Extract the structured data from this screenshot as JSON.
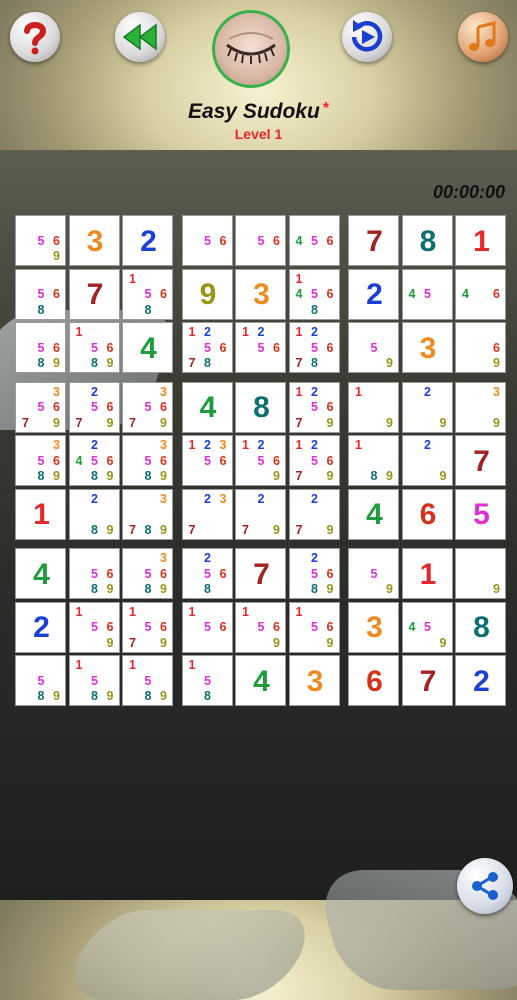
{
  "header": {
    "title": "Easy Sudoku",
    "title_star": "*",
    "level": "Level 1",
    "timer": "00:00:00"
  },
  "buttons": {
    "help_icon": "question-mark",
    "back_icon": "rewind",
    "forward_icon": "play-forward",
    "music_icon": "music-note",
    "eye_icon": "closed-eye",
    "share_icon": "share"
  },
  "colors": {
    "1": "#e8262c",
    "2": "#1c40d6",
    "3": "#f08a1e",
    "4": "#1f9c3c",
    "5": "#e12fd8",
    "6": "#d8311a",
    "7": "#a52222",
    "8": "#0e6f70",
    "9": "#98951b"
  },
  "grid": [
    [
      {
        "c": [
          5,
          6,
          9
        ]
      },
      {
        "v": 3
      },
      {
        "v": 2
      },
      {
        "c": [
          5,
          6
        ]
      },
      {
        "c": [
          5,
          6
        ]
      },
      {
        "c": [
          4,
          5,
          6
        ]
      },
      {
        "v": 7
      },
      {
        "v": 8
      },
      {
        "v": 1
      }
    ],
    [
      {
        "c": [
          5,
          6,
          8
        ]
      },
      {
        "v": 7
      },
      {
        "c": [
          1,
          5,
          6,
          8
        ]
      },
      {
        "v": 9
      },
      {
        "v": 3
      },
      {
        "c": [
          1,
          4,
          5,
          6,
          8
        ]
      },
      {
        "v": 2
      },
      {
        "c": [
          4,
          5
        ]
      },
      {
        "c": [
          4,
          6
        ]
      }
    ],
    [
      {
        "c": [
          5,
          6,
          8,
          9
        ]
      },
      {
        "c": [
          1,
          5,
          6,
          8,
          9
        ]
      },
      {
        "v": 4
      },
      {
        "c": [
          1,
          2,
          5,
          6,
          7,
          8
        ]
      },
      {
        "c": [
          1,
          2,
          5,
          6
        ]
      },
      {
        "c": [
          1,
          2,
          5,
          6,
          7,
          8
        ]
      },
      {
        "c": [
          5,
          9
        ]
      },
      {
        "v": 3
      },
      {
        "c": [
          6,
          9
        ]
      }
    ],
    [
      {
        "c": [
          3,
          5,
          6,
          7,
          9
        ]
      },
      {
        "c": [
          2,
          5,
          6,
          7,
          9
        ]
      },
      {
        "c": [
          3,
          5,
          6,
          7,
          9
        ]
      },
      {
        "v": 4
      },
      {
        "v": 8
      },
      {
        "c": [
          1,
          2,
          5,
          6,
          7,
          9
        ]
      },
      {
        "c": [
          1,
          9
        ]
      },
      {
        "c": [
          2,
          9
        ]
      },
      {
        "c": [
          3,
          9
        ]
      }
    ],
    [
      {
        "c": [
          3,
          5,
          6,
          8,
          9
        ]
      },
      {
        "c": [
          2,
          4,
          5,
          6,
          8,
          9
        ]
      },
      {
        "c": [
          3,
          5,
          6,
          8,
          9
        ]
      },
      {
        "c": [
          1,
          2,
          3,
          5,
          6
        ]
      },
      {
        "c": [
          1,
          2,
          5,
          6,
          9
        ]
      },
      {
        "c": [
          1,
          2,
          5,
          6,
          7,
          9
        ]
      },
      {
        "c": [
          1,
          8,
          9
        ]
      },
      {
        "c": [
          2,
          9
        ]
      },
      {
        "v": 7
      }
    ],
    [
      {
        "v": 1
      },
      {
        "c": [
          2,
          8,
          9
        ]
      },
      {
        "c": [
          3,
          7,
          8,
          9
        ]
      },
      {
        "c": [
          2,
          3,
          7
        ]
      },
      {
        "c": [
          2,
          7,
          9
        ]
      },
      {
        "c": [
          2,
          7,
          9
        ]
      },
      {
        "v": 4
      },
      {
        "v": 6
      },
      {
        "v": 5
      }
    ],
    [
      {
        "v": 4
      },
      {
        "c": [
          5,
          6,
          8,
          9
        ]
      },
      {
        "c": [
          3,
          5,
          6,
          8,
          9
        ]
      },
      {
        "c": [
          2,
          5,
          6,
          8
        ]
      },
      {
        "v": 7
      },
      {
        "c": [
          2,
          5,
          6,
          8,
          9
        ]
      },
      {
        "c": [
          5,
          9
        ]
      },
      {
        "v": 1
      },
      {
        "c": [
          9
        ]
      }
    ],
    [
      {
        "v": 2
      },
      {
        "c": [
          1,
          5,
          6,
          9
        ]
      },
      {
        "c": [
          1,
          5,
          6,
          7,
          9
        ]
      },
      {
        "c": [
          1,
          5,
          6
        ]
      },
      {
        "c": [
          1,
          5,
          6,
          9
        ]
      },
      {
        "c": [
          1,
          5,
          6,
          9
        ]
      },
      {
        "v": 3
      },
      {
        "c": [
          4,
          5,
          9
        ]
      },
      {
        "v": 8
      }
    ],
    [
      {
        "c": [
          5,
          8,
          9
        ]
      },
      {
        "c": [
          1,
          5,
          8,
          9
        ]
      },
      {
        "c": [
          1,
          5,
          8,
          9
        ]
      },
      {
        "c": [
          1,
          5,
          8
        ]
      },
      {
        "v": 4
      },
      {
        "v": 3
      },
      {
        "v": 6
      },
      {
        "v": 7
      },
      {
        "v": 2
      }
    ]
  ]
}
